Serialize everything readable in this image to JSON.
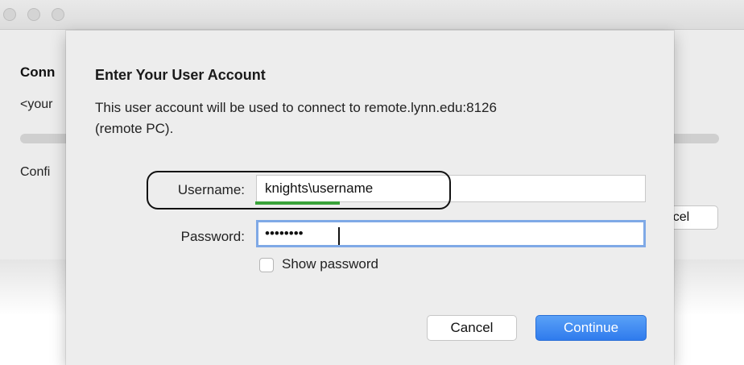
{
  "background_window": {
    "title": "Conn",
    "subtitle": "<your",
    "status": "Confi",
    "cancel_label": "cel"
  },
  "dialog": {
    "title": "Enter Your User Account",
    "description": "This user account will be used to connect to remote.lynn.edu:8126 (remote PC).",
    "username_label": "Username:",
    "username_value": "knights\\username",
    "password_label": "Password:",
    "password_value": "••••••••",
    "show_password_label": "Show password",
    "show_password_checked": false,
    "cancel_label": "Cancel",
    "continue_label": "Continue"
  },
  "colors": {
    "accent": "#2f7bed",
    "focus_ring": "#7fa9e6",
    "annotation_underline": "#3aa33a"
  }
}
